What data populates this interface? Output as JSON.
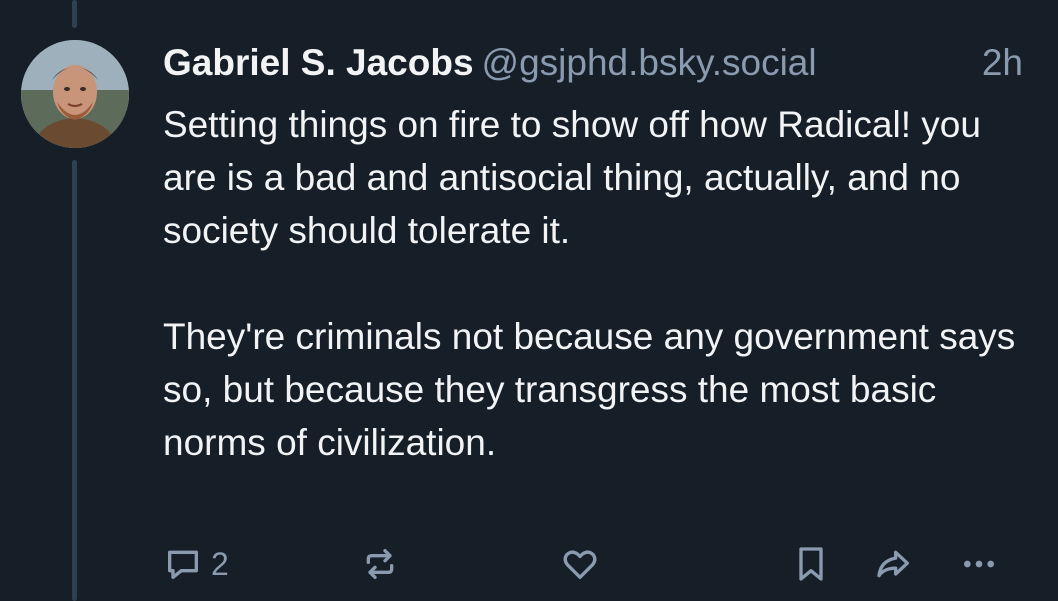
{
  "post": {
    "author_name": "Gabriel S. Jacobs",
    "author_handle": "@gsjphd.bsky.social",
    "time_ago": "2h",
    "paragraphs": [
      "Setting things on fire to show off how Radical! you are is a bad and antisocial thing, actually, and no society should tolerate it.",
      "They're criminals not because any government says so, but because they transgress the most basic norms of civilization."
    ]
  },
  "actions": {
    "reply_count": "2",
    "icons": [
      "reply-icon",
      "repost-icon",
      "like-icon",
      "bookmark-icon",
      "share-icon",
      "more-icon"
    ]
  },
  "colors": {
    "background": "#161e27",
    "thread_line": "#2e4052",
    "text": "#f1f3f5",
    "muted": "#8a9bb0"
  }
}
